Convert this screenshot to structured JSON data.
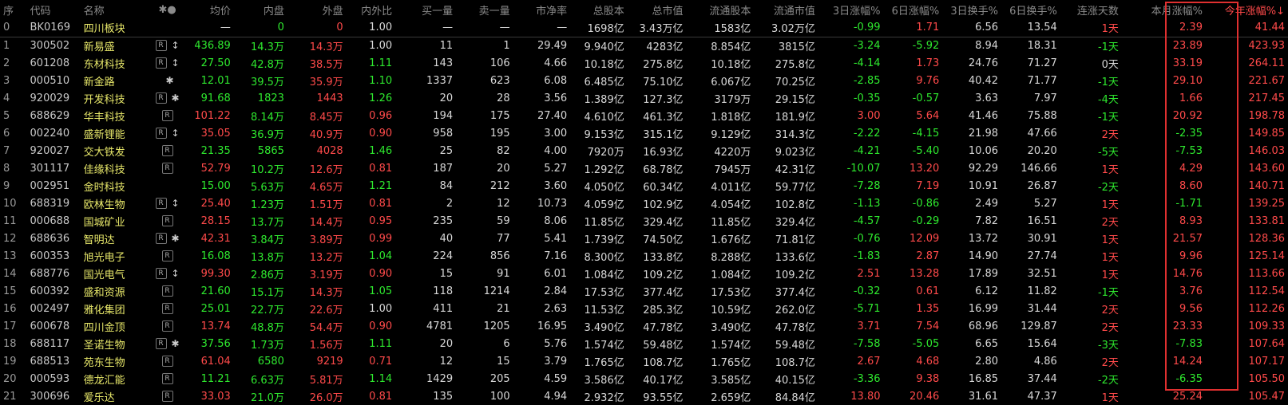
{
  "columns": {
    "seq": "序",
    "code": "代码",
    "name": "名称",
    "marks": "✱●",
    "avg": "均价",
    "inner": "内盘",
    "outer": "外盘",
    "ratio": "内外比",
    "buy": "买一量",
    "sell": "卖一量",
    "pb": "市净率",
    "total_shares": "总股本",
    "total_mv": "总市值",
    "float_shares": "流通股本",
    "float_mv": "流通市值",
    "chg3": "3日涨幅%",
    "chg6": "6日涨幅%",
    "turn3": "3日换手%",
    "turn6": "6日换手%",
    "up_days": "连涨天数",
    "month_chg": "本月涨幅%",
    "year_chg": "今年涨幅%↓"
  },
  "rows": [
    {
      "seq": "0",
      "code": "BK0169",
      "name": "四川板块",
      "badge": "",
      "mark": "",
      "avg": "—",
      "inner": "0",
      "outer": "0",
      "ratio": "1.00",
      "buy": "—",
      "sell": "—",
      "pb": "—",
      "total_shares": "1698亿",
      "total_mv": "3.43万亿",
      "float_shares": "1583亿",
      "float_mv": "3.02万亿",
      "chg3": "-0.99",
      "chg6": "1.71",
      "turn3": "6.56",
      "turn6": "13.54",
      "up_days": "1天",
      "month_chg": "2.39",
      "year_chg": "41.44"
    },
    {
      "seq": "1",
      "code": "300502",
      "name": "新易盛",
      "badge": "R",
      "mark": "↕",
      "avg": "436.89",
      "inner": "14.3万",
      "outer": "14.3万",
      "ratio": "1.00",
      "buy": "11",
      "sell": "1",
      "pb": "29.49",
      "total_shares": "9.940亿",
      "total_mv": "4283亿",
      "float_shares": "8.854亿",
      "float_mv": "3815亿",
      "chg3": "-3.24",
      "chg6": "-5.92",
      "turn3": "8.94",
      "turn6": "18.31",
      "up_days": "-1天",
      "month_chg": "23.89",
      "year_chg": "423.93"
    },
    {
      "seq": "2",
      "code": "601208",
      "name": "东材科技",
      "badge": "R",
      "mark": "↕",
      "avg": "27.50",
      "inner": "42.8万",
      "outer": "38.5万",
      "ratio": "1.11",
      "buy": "143",
      "sell": "106",
      "pb": "4.66",
      "total_shares": "10.18亿",
      "total_mv": "275.8亿",
      "float_shares": "10.18亿",
      "float_mv": "275.8亿",
      "chg3": "-4.14",
      "chg6": "1.73",
      "turn3": "24.76",
      "turn6": "71.27",
      "up_days": "0天",
      "month_chg": "33.19",
      "year_chg": "264.11"
    },
    {
      "seq": "3",
      "code": "000510",
      "name": "新金路",
      "badge": "",
      "mark": "✱",
      "avg": "12.01",
      "inner": "39.5万",
      "outer": "35.9万",
      "ratio": "1.10",
      "buy": "1337",
      "sell": "623",
      "pb": "6.08",
      "total_shares": "6.485亿",
      "total_mv": "75.10亿",
      "float_shares": "6.067亿",
      "float_mv": "70.25亿",
      "chg3": "-2.85",
      "chg6": "9.76",
      "turn3": "40.42",
      "turn6": "71.77",
      "up_days": "-1天",
      "month_chg": "29.10",
      "year_chg": "221.67"
    },
    {
      "seq": "4",
      "code": "920029",
      "name": "开发科技",
      "badge": "R",
      "mark": "✱",
      "avg": "91.68",
      "inner": "1823",
      "outer": "1443",
      "ratio": "1.26",
      "buy": "20",
      "sell": "28",
      "pb": "3.56",
      "total_shares": "1.389亿",
      "total_mv": "127.3亿",
      "float_shares": "3179万",
      "float_mv": "29.15亿",
      "chg3": "-0.35",
      "chg6": "-0.57",
      "turn3": "3.63",
      "turn6": "7.97",
      "up_days": "-4天",
      "month_chg": "1.66",
      "year_chg": "217.45"
    },
    {
      "seq": "5",
      "code": "688629",
      "name": "华丰科技",
      "badge": "R",
      "mark": "",
      "avg": "101.22",
      "inner": "8.14万",
      "outer": "8.45万",
      "ratio": "0.96",
      "buy": "194",
      "sell": "175",
      "pb": "27.40",
      "total_shares": "4.610亿",
      "total_mv": "461.3亿",
      "float_shares": "1.818亿",
      "float_mv": "181.9亿",
      "chg3": "3.00",
      "chg6": "5.64",
      "turn3": "41.46",
      "turn6": "75.88",
      "up_days": "-1天",
      "month_chg": "20.92",
      "year_chg": "198.78"
    },
    {
      "seq": "6",
      "code": "002240",
      "name": "盛新锂能",
      "badge": "R",
      "mark": "↕",
      "avg": "35.05",
      "inner": "36.9万",
      "outer": "40.9万",
      "ratio": "0.90",
      "buy": "958",
      "sell": "195",
      "pb": "3.00",
      "total_shares": "9.153亿",
      "total_mv": "315.1亿",
      "float_shares": "9.129亿",
      "float_mv": "314.3亿",
      "chg3": "-2.22",
      "chg6": "-4.15",
      "turn3": "21.98",
      "turn6": "47.66",
      "up_days": "2天",
      "month_chg": "-2.35",
      "year_chg": "149.85"
    },
    {
      "seq": "7",
      "code": "920027",
      "name": "交大铁发",
      "badge": "R",
      "mark": "",
      "avg": "21.35",
      "inner": "5865",
      "outer": "4028",
      "ratio": "1.46",
      "buy": "25",
      "sell": "82",
      "pb": "4.00",
      "total_shares": "7920万",
      "total_mv": "16.93亿",
      "float_shares": "4220万",
      "float_mv": "9.023亿",
      "chg3": "-4.21",
      "chg6": "-5.40",
      "turn3": "10.06",
      "turn6": "20.20",
      "up_days": "-5天",
      "month_chg": "-7.53",
      "year_chg": "146.03"
    },
    {
      "seq": "8",
      "code": "301117",
      "name": "佳缘科技",
      "badge": "R",
      "mark": "",
      "avg": "52.79",
      "inner": "10.2万",
      "outer": "12.6万",
      "ratio": "0.81",
      "buy": "187",
      "sell": "20",
      "pb": "5.27",
      "total_shares": "1.292亿",
      "total_mv": "68.78亿",
      "float_shares": "7945万",
      "float_mv": "42.31亿",
      "chg3": "-10.07",
      "chg6": "13.20",
      "turn3": "92.29",
      "turn6": "146.66",
      "up_days": "1天",
      "month_chg": "4.29",
      "year_chg": "143.60"
    },
    {
      "seq": "9",
      "code": "002951",
      "name": "金时科技",
      "badge": "",
      "mark": "",
      "avg": "15.00",
      "inner": "5.63万",
      "outer": "4.65万",
      "ratio": "1.21",
      "buy": "84",
      "sell": "212",
      "pb": "3.60",
      "total_shares": "4.050亿",
      "total_mv": "60.34亿",
      "float_shares": "4.011亿",
      "float_mv": "59.77亿",
      "chg3": "-7.28",
      "chg6": "7.19",
      "turn3": "10.91",
      "turn6": "26.87",
      "up_days": "-2天",
      "month_chg": "8.60",
      "year_chg": "140.71"
    },
    {
      "seq": "10",
      "code": "688319",
      "name": "欧林生物",
      "badge": "R",
      "mark": "↕",
      "avg": "25.40",
      "inner": "1.23万",
      "outer": "1.51万",
      "ratio": "0.81",
      "buy": "2",
      "sell": "12",
      "pb": "10.73",
      "total_shares": "4.059亿",
      "total_mv": "102.9亿",
      "float_shares": "4.054亿",
      "float_mv": "102.8亿",
      "chg3": "-1.13",
      "chg6": "-0.86",
      "turn3": "2.49",
      "turn6": "5.27",
      "up_days": "1天",
      "month_chg": "-1.71",
      "year_chg": "139.25"
    },
    {
      "seq": "11",
      "code": "000688",
      "name": "国城矿业",
      "badge": "R",
      "mark": "",
      "avg": "28.15",
      "inner": "13.7万",
      "outer": "14.4万",
      "ratio": "0.95",
      "buy": "235",
      "sell": "59",
      "pb": "8.06",
      "total_shares": "11.85亿",
      "total_mv": "329.4亿",
      "float_shares": "11.85亿",
      "float_mv": "329.4亿",
      "chg3": "-4.57",
      "chg6": "-0.29",
      "turn3": "7.82",
      "turn6": "16.51",
      "up_days": "2天",
      "month_chg": "8.93",
      "year_chg": "133.81"
    },
    {
      "seq": "12",
      "code": "688636",
      "name": "智明达",
      "badge": "R",
      "mark": "✱",
      "avg": "42.31",
      "inner": "3.84万",
      "outer": "3.89万",
      "ratio": "0.99",
      "buy": "40",
      "sell": "77",
      "pb": "5.41",
      "total_shares": "1.739亿",
      "total_mv": "74.50亿",
      "float_shares": "1.676亿",
      "float_mv": "71.81亿",
      "chg3": "-0.76",
      "chg6": "12.09",
      "turn3": "13.72",
      "turn6": "30.91",
      "up_days": "1天",
      "month_chg": "21.57",
      "year_chg": "128.36"
    },
    {
      "seq": "13",
      "code": "600353",
      "name": "旭光电子",
      "badge": "R",
      "mark": "",
      "avg": "16.08",
      "inner": "13.8万",
      "outer": "13.2万",
      "ratio": "1.04",
      "buy": "224",
      "sell": "856",
      "pb": "7.16",
      "total_shares": "8.300亿",
      "total_mv": "133.8亿",
      "float_shares": "8.288亿",
      "float_mv": "133.6亿",
      "chg3": "-1.83",
      "chg6": "2.87",
      "turn3": "14.90",
      "turn6": "27.74",
      "up_days": "1天",
      "month_chg": "9.96",
      "year_chg": "125.14"
    },
    {
      "seq": "14",
      "code": "688776",
      "name": "国光电气",
      "badge": "R",
      "mark": "↕",
      "avg": "99.30",
      "inner": "2.86万",
      "outer": "3.19万",
      "ratio": "0.90",
      "buy": "15",
      "sell": "91",
      "pb": "6.01",
      "total_shares": "1.084亿",
      "total_mv": "109.2亿",
      "float_shares": "1.084亿",
      "float_mv": "109.2亿",
      "chg3": "2.51",
      "chg6": "13.28",
      "turn3": "17.89",
      "turn6": "32.51",
      "up_days": "1天",
      "month_chg": "14.76",
      "year_chg": "113.66"
    },
    {
      "seq": "15",
      "code": "600392",
      "name": "盛和资源",
      "badge": "R",
      "mark": "",
      "avg": "21.60",
      "inner": "15.1万",
      "outer": "14.3万",
      "ratio": "1.05",
      "buy": "118",
      "sell": "1214",
      "pb": "2.84",
      "total_shares": "17.53亿",
      "total_mv": "377.4亿",
      "float_shares": "17.53亿",
      "float_mv": "377.4亿",
      "chg3": "-0.32",
      "chg6": "0.61",
      "turn3": "6.12",
      "turn6": "11.82",
      "up_days": "-1天",
      "month_chg": "3.76",
      "year_chg": "112.54"
    },
    {
      "seq": "16",
      "code": "002497",
      "name": "雅化集团",
      "badge": "R",
      "mark": "",
      "avg": "25.01",
      "inner": "22.7万",
      "outer": "22.6万",
      "ratio": "1.00",
      "buy": "411",
      "sell": "21",
      "pb": "2.63",
      "total_shares": "11.53亿",
      "total_mv": "285.3亿",
      "float_shares": "10.59亿",
      "float_mv": "262.0亿",
      "chg3": "-5.71",
      "chg6": "1.35",
      "turn3": "16.99",
      "turn6": "31.44",
      "up_days": "2天",
      "month_chg": "9.56",
      "year_chg": "112.26"
    },
    {
      "seq": "17",
      "code": "600678",
      "name": "四川金顶",
      "badge": "R",
      "mark": "",
      "avg": "13.74",
      "inner": "48.8万",
      "outer": "54.4万",
      "ratio": "0.90",
      "buy": "4781",
      "sell": "1205",
      "pb": "16.95",
      "total_shares": "3.490亿",
      "total_mv": "47.78亿",
      "float_shares": "3.490亿",
      "float_mv": "47.78亿",
      "chg3": "3.71",
      "chg6": "7.54",
      "turn3": "68.96",
      "turn6": "129.87",
      "up_days": "2天",
      "month_chg": "23.33",
      "year_chg": "109.33"
    },
    {
      "seq": "18",
      "code": "688117",
      "name": "圣诺生物",
      "badge": "R",
      "mark": "✱",
      "avg": "37.56",
      "inner": "1.73万",
      "outer": "1.56万",
      "ratio": "1.11",
      "buy": "20",
      "sell": "6",
      "pb": "5.76",
      "total_shares": "1.574亿",
      "total_mv": "59.48亿",
      "float_shares": "1.574亿",
      "float_mv": "59.48亿",
      "chg3": "-7.58",
      "chg6": "-5.05",
      "turn3": "6.65",
      "turn6": "15.64",
      "up_days": "-3天",
      "month_chg": "-7.83",
      "year_chg": "107.64"
    },
    {
      "seq": "19",
      "code": "688513",
      "name": "苑东生物",
      "badge": "R",
      "mark": "",
      "avg": "61.04",
      "inner": "6580",
      "outer": "9219",
      "ratio": "0.71",
      "buy": "12",
      "sell": "15",
      "pb": "3.79",
      "total_shares": "1.765亿",
      "total_mv": "108.7亿",
      "float_shares": "1.765亿",
      "float_mv": "108.7亿",
      "chg3": "2.67",
      "chg6": "4.68",
      "turn3": "2.80",
      "turn6": "4.86",
      "up_days": "2天",
      "month_chg": "14.24",
      "year_chg": "107.17"
    },
    {
      "seq": "20",
      "code": "000593",
      "name": "德龙汇能",
      "badge": "R",
      "mark": "",
      "avg": "11.21",
      "inner": "6.63万",
      "outer": "5.81万",
      "ratio": "1.14",
      "buy": "1429",
      "sell": "205",
      "pb": "4.59",
      "total_shares": "3.586亿",
      "total_mv": "40.17亿",
      "float_shares": "3.585亿",
      "float_mv": "40.15亿",
      "chg3": "-3.36",
      "chg6": "9.38",
      "turn3": "16.85",
      "turn6": "37.44",
      "up_days": "-2天",
      "month_chg": "-6.35",
      "year_chg": "105.50"
    },
    {
      "seq": "21",
      "code": "300696",
      "name": "爱乐达",
      "badge": "R",
      "mark": "",
      "avg": "33.03",
      "inner": "21.0万",
      "outer": "26.0万",
      "ratio": "0.81",
      "buy": "135",
      "sell": "100",
      "pb": "4.94",
      "total_shares": "2.932亿",
      "total_mv": "93.55亿",
      "float_shares": "2.659亿",
      "float_mv": "84.84亿",
      "chg3": "13.80",
      "chg6": "20.46",
      "turn3": "31.61",
      "turn6": "47.37",
      "up_days": "1天",
      "month_chg": "25.24",
      "year_chg": "105.47"
    }
  ],
  "colors": {
    "up": "#ff4a4a",
    "down": "#2ee82e",
    "flat": "#d8d8d8",
    "name": "#e8e86a",
    "highlight_border": "#e03030"
  }
}
